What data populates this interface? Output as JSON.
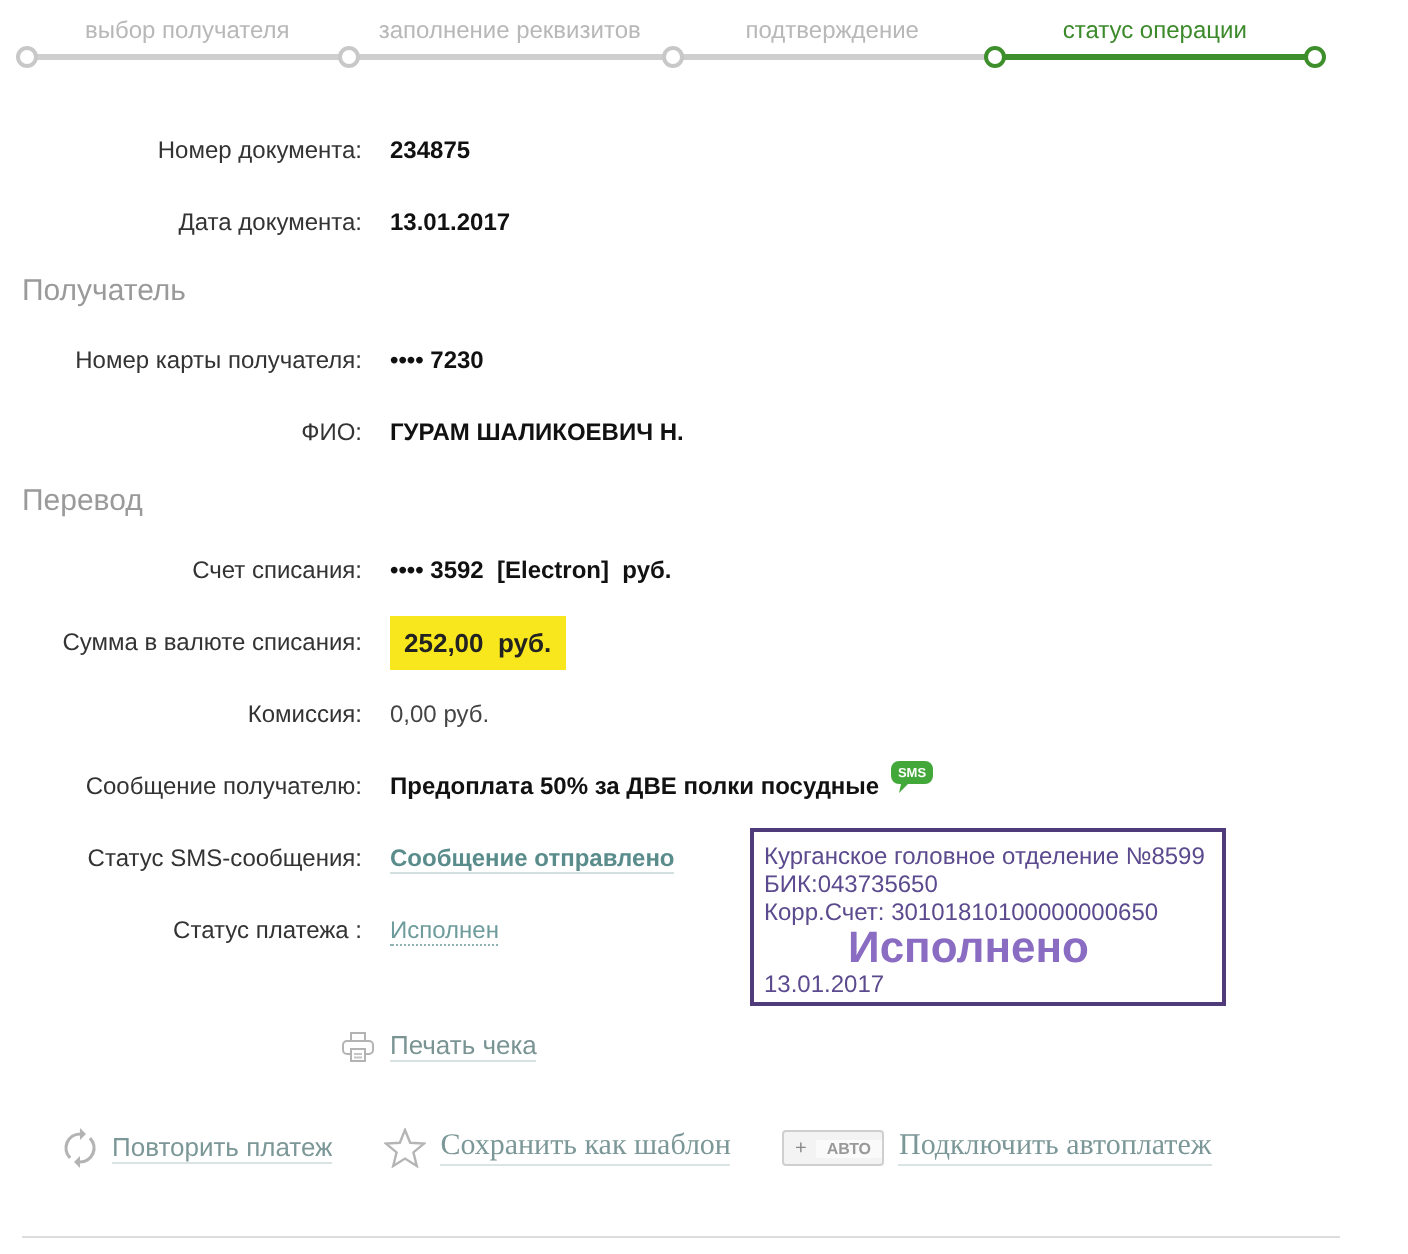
{
  "steps": [
    {
      "label": "выбор получателя",
      "selected": false
    },
    {
      "label": "заполнение реквизитов",
      "selected": false
    },
    {
      "label": "подтверждение",
      "selected": false
    },
    {
      "label": "статус операции",
      "selected": true
    }
  ],
  "sections": [
    {
      "rows": [
        {
          "label": "Номер документа:",
          "value": "234875",
          "kind": "bold"
        },
        {
          "label": "Дата документа:",
          "value": "13.01.2017",
          "kind": "bold"
        }
      ]
    },
    {
      "title": "Получатель",
      "rows": [
        {
          "label": "Номер карты получателя:",
          "value": "•••• 7230",
          "kind": "bold"
        },
        {
          "label": "ФИО:",
          "value": "ГУРАМ ШАЛИКОЕВИЧ Н.",
          "kind": "bold"
        }
      ]
    },
    {
      "title": "Перевод",
      "rows": [
        {
          "label": "Счет списания:",
          "value": "•••• 3592  [Electron]  руб.",
          "kind": "bold"
        },
        {
          "label": "Сумма в валюте списания:",
          "value": "252,00  руб.",
          "kind": "highlight"
        },
        {
          "label": "Комиссия:",
          "value": "0,00 руб.",
          "kind": "regular"
        },
        {
          "label": "Сообщение получателю:",
          "value": "Предоплата 50% за ДВЕ полки посудные",
          "kind": "bold",
          "badge": "SMS"
        },
        {
          "label": "Статус SMS-сообщения:",
          "value": "Сообщение отправлено",
          "kind": "bold_link"
        },
        {
          "label": "Статус платежа :",
          "value": "Исполнен",
          "kind": "link"
        }
      ]
    }
  ],
  "stamp": {
    "lines": [
      "Курганское головное отделение №8599",
      "БИК:043735650",
      "Корр.Счет: 30101810100000000650"
    ],
    "mark": "Исполнено",
    "date": "13.01.2017"
  },
  "print_link": {
    "label": "Печать чека"
  },
  "actions": [
    {
      "kind": "repeat",
      "label": "Повторить платеж"
    },
    {
      "kind": "template",
      "label": "Сохранить как шаблон"
    },
    {
      "kind": "autopay",
      "label": "Подключить автоплатеж",
      "badge_plus": "+",
      "badge": "АВТО"
    }
  ]
}
